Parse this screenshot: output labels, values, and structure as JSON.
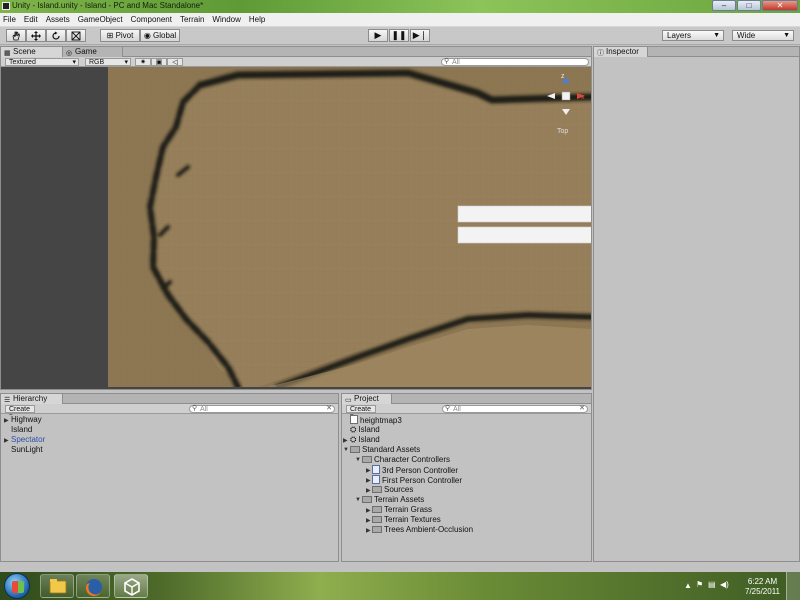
{
  "window": {
    "title": "Unity - Island.unity - Island - PC and Mac Standalone*"
  },
  "menu": [
    "File",
    "Edit",
    "Assets",
    "GameObject",
    "Component",
    "Terrain",
    "Window",
    "Help"
  ],
  "toolbar": {
    "pivot_label": "Pivot",
    "global_label": "Global",
    "layers_label": "Layers",
    "layout_label": "Wide"
  },
  "scene": {
    "tabs": [
      "Scene",
      "Game"
    ],
    "render_mode": "Textured",
    "color_mode": "RGB",
    "search_placeholder": "All",
    "gizmo_view_label": "Top",
    "gizmo_axis_x": "x",
    "gizmo_axis_z": "z"
  },
  "inspector": {
    "tab_label": "Inspector"
  },
  "hierarchy": {
    "tab_label": "Hierarchy",
    "create_label": "Create",
    "search_placeholder": "All",
    "items": [
      "Highway",
      "Island",
      "Spectator",
      "SunLight"
    ]
  },
  "project": {
    "tab_label": "Project",
    "create_label": "Create",
    "search_placeholder": "All",
    "items": [
      "heightmap3",
      "Island",
      "Island",
      "Standard Assets",
      "Character Controllers",
      "3rd Person Controller",
      "First Person Controller",
      "Sources",
      "Terrain Assets",
      "Terrain Grass",
      "Terrain Textures",
      "Trees Ambient-Occlusion"
    ]
  },
  "taskbar": {
    "time": "6:22 AM",
    "date": "7/25/2011"
  },
  "colors": {
    "terrain": "#8d7753",
    "panel": "#c2c2c2",
    "selection": "#2c4fa8"
  }
}
